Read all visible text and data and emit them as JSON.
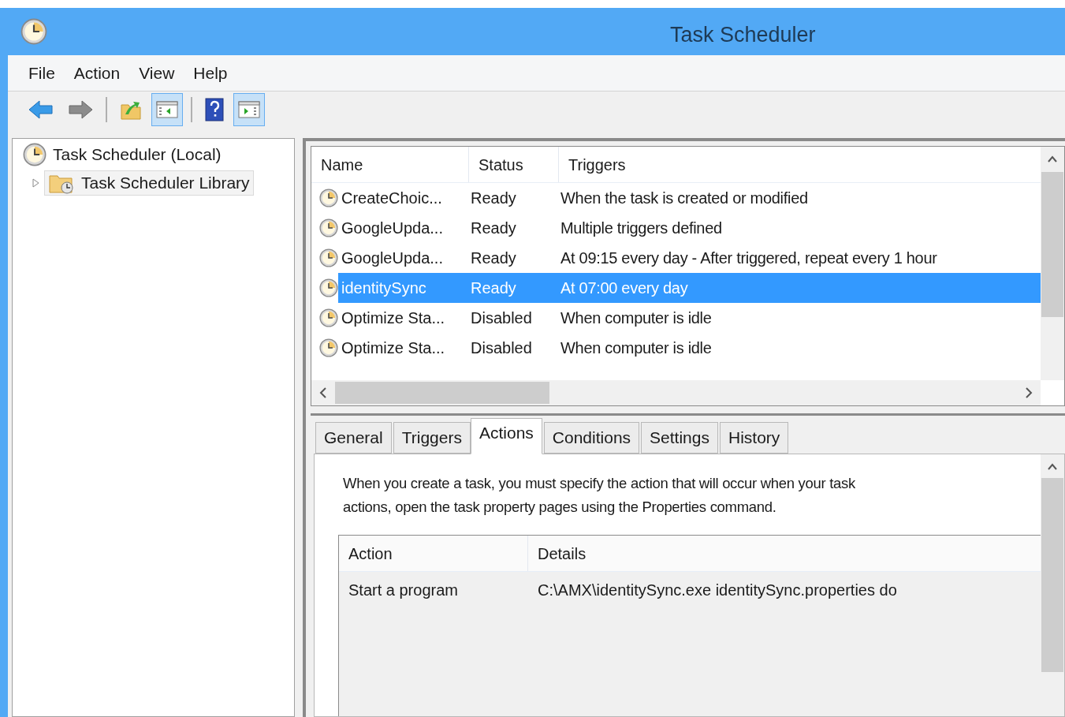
{
  "window": {
    "title": "Task Scheduler"
  },
  "menu": [
    "File",
    "Action",
    "View",
    "Help"
  ],
  "toolbar": [
    [
      {
        "kind": "back",
        "pressed": false
      },
      {
        "kind": "forward",
        "pressed": false
      }
    ],
    [
      {
        "kind": "up",
        "pressed": false
      },
      {
        "kind": "tree",
        "pressed": true
      }
    ],
    [
      {
        "kind": "help",
        "pressed": false
      },
      {
        "kind": "pane",
        "pressed": true
      }
    ]
  ],
  "tree": [
    {
      "label": "Task Scheduler (Local)",
      "selected": false,
      "children": [
        {
          "label": "Task Scheduler Library",
          "expanded": false,
          "selected": true
        }
      ]
    }
  ],
  "tasks": {
    "columns": [
      "Name",
      "Status",
      "Triggers"
    ],
    "rows": [
      {
        "name": "CreateChoic...",
        "status": "Ready",
        "triggers": "When the task is created or modified",
        "selected": false
      },
      {
        "name": "GoogleUpda...",
        "status": "Ready",
        "triggers": "Multiple triggers defined",
        "selected": false
      },
      {
        "name": "GoogleUpda...",
        "status": "Ready",
        "triggers": "At 09:15 every day - After triggered, repeat every 1 hour",
        "selected": false
      },
      {
        "name": "identitySync",
        "status": "Ready",
        "triggers": "At 07:00 every day",
        "selected": true
      },
      {
        "name": "Optimize Sta...",
        "status": "Disabled",
        "triggers": "When computer is idle",
        "selected": false
      },
      {
        "name": "Optimize Sta...",
        "status": "Disabled",
        "triggers": "When computer is idle",
        "selected": false
      }
    ]
  },
  "tabs": [
    {
      "label": "General",
      "selected": false
    },
    {
      "label": "Triggers",
      "selected": false
    },
    {
      "label": "Actions",
      "selected": true
    },
    {
      "label": "Conditions",
      "selected": false
    },
    {
      "label": "Settings",
      "selected": false
    },
    {
      "label": "History",
      "selected": false
    }
  ],
  "actions": {
    "description": [
      "When you create a task, you must specify the action that will occur when your task",
      "actions, open the task property pages using the Properties command."
    ],
    "columns": [
      "Action",
      "Details"
    ],
    "rows": [
      {
        "action": "Start a program",
        "details": "C:\\AMX\\identitySync.exe identitySync.properties do"
      }
    ]
  }
}
